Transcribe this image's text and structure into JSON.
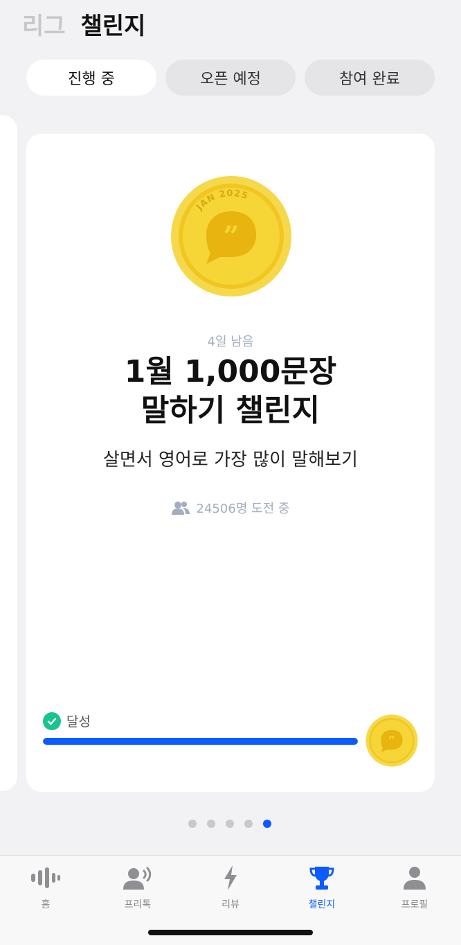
{
  "header": {
    "tabs": [
      {
        "label": "리그",
        "active": false
      },
      {
        "label": "챌린지",
        "active": true
      }
    ]
  },
  "filters": [
    {
      "label": "진행 중",
      "active": true
    },
    {
      "label": "오픈 예정",
      "active": false
    },
    {
      "label": "참여 완료",
      "active": false
    }
  ],
  "card": {
    "badge_text": "JAN 2025",
    "days_left": "4일 남음",
    "title_line1": "1월 1,000문장",
    "title_line2": "말하기 챌린지",
    "description": "살면서 영어로 가장 많이 말해보기",
    "participants": "24506명 도전 중",
    "achievement_label": "달성",
    "progress": 1.0
  },
  "pager": {
    "count": 5,
    "active_index": 4
  },
  "bottom_nav": [
    {
      "label": "홈",
      "icon": "voice-wave-icon",
      "active": false
    },
    {
      "label": "프리톡",
      "icon": "speaker-person-icon",
      "active": false
    },
    {
      "label": "리뷰",
      "icon": "lightning-icon",
      "active": false
    },
    {
      "label": "챌린지",
      "icon": "trophy-icon",
      "active": true
    },
    {
      "label": "프로필",
      "icon": "person-icon",
      "active": false
    }
  ],
  "colors": {
    "accent": "#0d5bff",
    "success": "#18c490",
    "coin_gold": "#f4d02a",
    "muted_text": "#a2adbd"
  }
}
